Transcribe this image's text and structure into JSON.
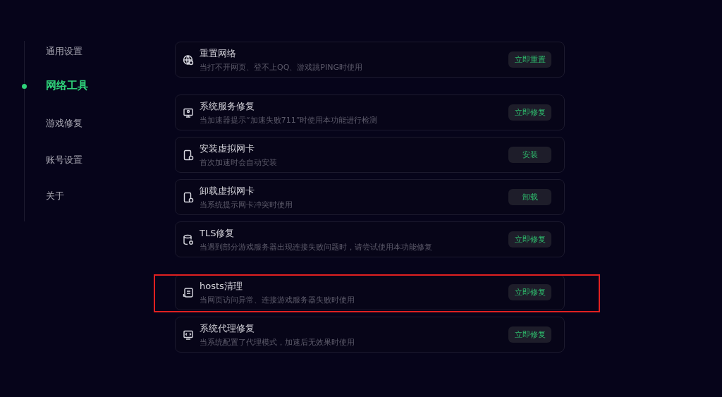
{
  "sidebar": {
    "items": [
      {
        "label": "通用设置",
        "selected": false
      },
      {
        "label": "网络工具",
        "selected": true
      },
      {
        "label": "游戏修复",
        "selected": false
      },
      {
        "label": "账号设置",
        "selected": false
      },
      {
        "label": "关于",
        "selected": false
      }
    ]
  },
  "tool_groups": [
    {
      "tools": [
        {
          "title": "重置网络",
          "description": "当打不开网页、登不上QQ、游戏跳PING时使用",
          "button": "立即重置",
          "highlighted": false
        }
      ]
    },
    {
      "tools": [
        {
          "title": "系统服务修复",
          "description": "当加速器提示“加速失败711”时使用本功能进行检测",
          "button": "立即修复",
          "highlighted": false
        },
        {
          "title": "安装虚拟网卡",
          "description": "首次加速时会自动安装",
          "button": "安装",
          "highlighted": false
        },
        {
          "title": "卸载虚拟网卡",
          "description": "当系统提示网卡冲突时使用",
          "button": "卸载",
          "highlighted": false
        },
        {
          "title": "TLS修复",
          "description": "当遇到部分游戏服务器出现连接失败问题时，请尝试使用本功能修复",
          "button": "立即修复",
          "highlighted": false
        }
      ]
    },
    {
      "tools": [
        {
          "title": "hosts清理",
          "description": "当网页访问异常、连接游戏服务器失败时使用",
          "button": "立即修复",
          "highlighted": true
        },
        {
          "title": "系统代理修复",
          "description": "当系统配置了代理模式，加速后无效果时使用",
          "button": "立即修复",
          "highlighted": false
        }
      ]
    }
  ]
}
